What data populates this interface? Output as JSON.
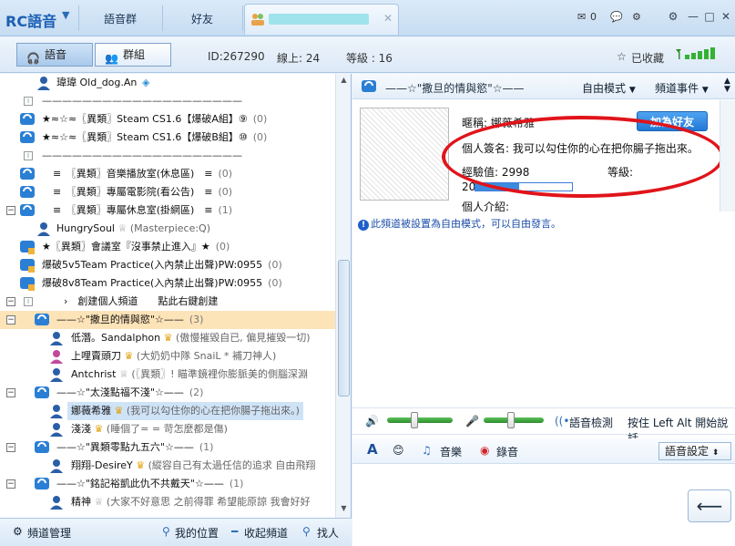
{
  "app": {
    "logo": "RC語音",
    "tabs": [
      "語音群",
      "好友"
    ]
  },
  "titlebar": {
    "mail_count": "0"
  },
  "mode_tabs": {
    "voice": "語音",
    "group": "群組"
  },
  "status": {
    "id": "ID:267290",
    "online": "線上: 24",
    "level": "等級 : 16",
    "favorited": "已收藏"
  },
  "channels": [
    {
      "text": "瑋瑋 Old_dog.An",
      "kind": "user"
    },
    {
      "text": "i",
      "kind": "info",
      "line": "————————————————————"
    },
    {
      "text": "★≈☆≈〖異類〗Steam CS1.6【爆破A組】⑨",
      "count": "(0)"
    },
    {
      "text": "★≈☆≈〖異類〗Steam CS1.6【爆破B組】⑩",
      "count": "(0)"
    },
    {
      "text": "i",
      "kind": "info",
      "line": "————————————————————"
    },
    {
      "text": "≡　〖異類〗音樂播放室(休息區)　≡",
      "count": "(0)"
    },
    {
      "text": "≡　〖異類〗專屬電影院(看公告)　≡",
      "count": "(0)"
    },
    {
      "text": "≡　〖異類〗專屬休息室(掛網區)　≡",
      "count": "(1)"
    },
    {
      "text": "HungrySoul",
      "sig": "(Masterpiece:Q)",
      "kind": "user"
    },
    {
      "text": "★〖異類〗會議室『沒事禁止進入』★",
      "count": "(0)"
    },
    {
      "text": "爆破5v5Team Practice(入內禁止出聲)PW:0955",
      "count": "(0)"
    },
    {
      "text": "爆破8v8Team Practice(入內禁止出聲)PW:0955",
      "count": "(0)"
    },
    {
      "text": "›　創建個人頻道　　點此右鍵創建",
      "kind": "info"
    },
    {
      "text": "——☆\"撒旦的情與慾\"☆——",
      "count": "(3)"
    },
    {
      "text": "低潛。Sandalphon",
      "sig": "(傲慢摧毀自已, 偏見摧毀一切)"
    },
    {
      "text": "上哩賣頭刀",
      "sig": "(大奶奶中隊 SnaiL * 補刀神人)"
    },
    {
      "text": "Antchrist",
      "sig": "(〖異類〗! 瞄準鏡裡你膨脈美的側腦深淵"
    },
    {
      "text": "——☆\"太淺點福不淺\"☆——",
      "count": "(2)"
    },
    {
      "text": "娜薇希雅",
      "sig": "(我可以勾住你的心在把你腸子拖出來。)"
    },
    {
      "text": "淺淺",
      "sig": "(睡個了= = 苛怎麼都是傷)"
    },
    {
      "text": "——☆\"異類零點九五六\"☆——",
      "count": "(1)"
    },
    {
      "text": "翔翔-DesireY",
      "sig": "(縱容自己有太過任信的追求 自由飛翔"
    },
    {
      "text": "——☆\"銘記裕凱此仇不共戴天\"☆——",
      "count": "(1)"
    },
    {
      "text": "精神",
      "sig": "(大家不好意思 之前得罪 希望能原諒 我會好好"
    }
  ],
  "left_bottom": {
    "manage": "頻道管理",
    "my_location": "我的位置",
    "collapse": "收起頻道",
    "find": "找人"
  },
  "channel_bar": {
    "title": "——☆\"撒旦的情與慾\"☆——",
    "mode": "自由模式",
    "events": "頻道事件"
  },
  "profile": {
    "nickname_label": "暱稱:",
    "nickname": "娜薇希雅",
    "add_friend": "加為好友",
    "signature_label": "個人簽名:",
    "signature": "我可以勾住你的心在把你腸子拖出來。",
    "exp_label": "經驗值:",
    "exp": "2998",
    "level_label": "等級:",
    "level": "20",
    "intro_label": "個人介紹:",
    "exp_progress": 0.45
  },
  "notice": "此頻道被設置為自由模式，可以自由發言。",
  "voice": {
    "detect": "語音檢測",
    "ptt_hint": "按住 Left Alt 開始說話",
    "speaker_level": 0.4,
    "mic_level": 0.45
  },
  "input_bar": {
    "music": "音樂",
    "record": "錄音",
    "voice_setting": "語音設定"
  },
  "colors": {
    "accent": "#1a5fb4",
    "highlight": "#fde3b8",
    "annotation": "#e0141a"
  }
}
